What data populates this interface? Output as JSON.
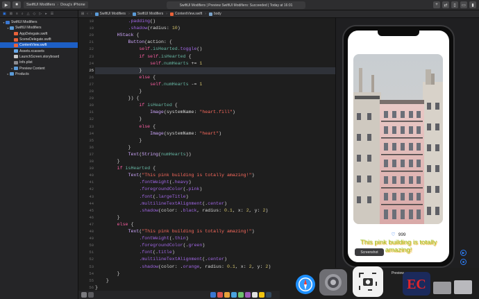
{
  "toolbar": {
    "scheme_project": "SwiftUI Modifiers",
    "scheme_device": "Doug's iPhone",
    "activity": "SwiftUI Modifiers | Preview SwiftUI Modifiers: Succeeded | Today at 16:01"
  },
  "jumpbar": {
    "crumbs": [
      "SwiftUI Modifiers",
      "SwiftUI Modifiers",
      "ContentView.swift",
      "body"
    ]
  },
  "navigator": {
    "items": [
      {
        "label": "SwiftUI Modifiers",
        "indent": 0,
        "icon": "proj",
        "disclosure": "▾",
        "selected": false
      },
      {
        "label": "SwiftUI Modifiers",
        "indent": 1,
        "icon": "folder",
        "disclosure": "▾",
        "selected": false
      },
      {
        "label": "AppDelegate.swift",
        "indent": 2,
        "icon": "swift",
        "disclosure": "",
        "selected": false
      },
      {
        "label": "SceneDelegate.swift",
        "indent": 2,
        "icon": "swift",
        "disclosure": "",
        "selected": false
      },
      {
        "label": "ContentView.swift",
        "indent": 2,
        "icon": "swift",
        "disclosure": "",
        "selected": true
      },
      {
        "label": "Assets.xcassets",
        "indent": 2,
        "icon": "assets",
        "disclosure": "",
        "selected": false
      },
      {
        "label": "LaunchScreen.storyboard",
        "indent": 2,
        "icon": "file",
        "disclosure": "",
        "selected": false
      },
      {
        "label": "Info.plist",
        "indent": 2,
        "icon": "grey",
        "disclosure": "",
        "selected": false
      },
      {
        "label": "Preview Content",
        "indent": 2,
        "icon": "folder",
        "disclosure": "▸",
        "selected": false
      },
      {
        "label": "Products",
        "indent": 1,
        "icon": "folder",
        "disclosure": "▸",
        "selected": false
      }
    ]
  },
  "editor": {
    "current_line": 25,
    "lines": [
      {
        "n": 18,
        "tokens": [
          [
            "            ",
            "id"
          ],
          [
            ".padding",
            "prop"
          ],
          [
            "()",
            "id"
          ]
        ]
      },
      {
        "n": 19,
        "tokens": [
          [
            "            ",
            "id"
          ],
          [
            ".shadow",
            "prop"
          ],
          [
            "(radius: ",
            "id"
          ],
          [
            "10",
            "num"
          ],
          [
            ")",
            "id"
          ]
        ]
      },
      {
        "n": 20,
        "tokens": [
          [
            "        ",
            "id"
          ],
          [
            "HStack",
            "type"
          ],
          [
            " {",
            "id"
          ]
        ]
      },
      {
        "n": 21,
        "tokens": [
          [
            "            ",
            "id"
          ],
          [
            "Button",
            "type"
          ],
          [
            "(action: {",
            "id"
          ]
        ]
      },
      {
        "n": 22,
        "tokens": [
          [
            "                ",
            "id"
          ],
          [
            "self",
            "kw"
          ],
          [
            ".isHearted.",
            "fn"
          ],
          [
            "toggle",
            "prop"
          ],
          [
            "()",
            "id"
          ]
        ]
      },
      {
        "n": 23,
        "tokens": [
          [
            "                ",
            "id"
          ],
          [
            "if",
            "kw"
          ],
          [
            " ",
            "id"
          ],
          [
            "self",
            "kw"
          ],
          [
            ".isHearted",
            "fn"
          ],
          [
            " {",
            "id"
          ]
        ]
      },
      {
        "n": 24,
        "tokens": [
          [
            "                    ",
            "id"
          ],
          [
            "self",
            "kw"
          ],
          [
            ".numHearts",
            "fn"
          ],
          [
            " += ",
            "id"
          ],
          [
            "1",
            "num"
          ]
        ]
      },
      {
        "n": 25,
        "tokens": [
          [
            "                ",
            "id"
          ],
          [
            "}",
            "id"
          ]
        ]
      },
      {
        "n": 26,
        "tokens": [
          [
            "                ",
            "id"
          ],
          [
            "else",
            "kw"
          ],
          [
            " {",
            "id"
          ]
        ]
      },
      {
        "n": 27,
        "tokens": [
          [
            "                    ",
            "id"
          ],
          [
            "self",
            "kw"
          ],
          [
            ".numHearts",
            "fn"
          ],
          [
            " -= ",
            "id"
          ],
          [
            "1",
            "num"
          ]
        ]
      },
      {
        "n": 28,
        "tokens": [
          [
            "                ",
            "id"
          ],
          [
            "}",
            "id"
          ]
        ]
      },
      {
        "n": 29,
        "tokens": [
          [
            "            ",
            "id"
          ],
          [
            "}) {",
            "id"
          ]
        ]
      },
      {
        "n": 30,
        "tokens": [
          [
            "                ",
            "id"
          ],
          [
            "if",
            "kw"
          ],
          [
            " ",
            "id"
          ],
          [
            "isHearted",
            "fn"
          ],
          [
            " {",
            "id"
          ]
        ]
      },
      {
        "n": 31,
        "tokens": [
          [
            "                    ",
            "id"
          ],
          [
            "Image",
            "type"
          ],
          [
            "(systemName: ",
            "id"
          ],
          [
            "\"heart.fill\"",
            "str"
          ],
          [
            ")",
            "id"
          ]
        ]
      },
      {
        "n": 32,
        "tokens": [
          [
            "                ",
            "id"
          ],
          [
            "}",
            "id"
          ]
        ]
      },
      {
        "n": 33,
        "tokens": [
          [
            "                ",
            "id"
          ],
          [
            "else",
            "kw"
          ],
          [
            " {",
            "id"
          ]
        ]
      },
      {
        "n": 34,
        "tokens": [
          [
            "                    ",
            "id"
          ],
          [
            "Image",
            "type"
          ],
          [
            "(systemName: ",
            "id"
          ],
          [
            "\"heart\"",
            "str"
          ],
          [
            ")",
            "id"
          ]
        ]
      },
      {
        "n": 35,
        "tokens": [
          [
            "                ",
            "id"
          ],
          [
            "}",
            "id"
          ]
        ]
      },
      {
        "n": 36,
        "tokens": [
          [
            "            ",
            "id"
          ],
          [
            "}",
            "id"
          ]
        ]
      },
      {
        "n": 37,
        "tokens": [
          [
            "            ",
            "id"
          ],
          [
            "Text",
            "type"
          ],
          [
            "(",
            "id"
          ],
          [
            "String",
            "type"
          ],
          [
            "(",
            "id"
          ],
          [
            "numHearts",
            "fn"
          ],
          [
            "))",
            "id"
          ]
        ]
      },
      {
        "n": 38,
        "tokens": [
          [
            "        ",
            "id"
          ],
          [
            "}",
            "id"
          ]
        ]
      },
      {
        "n": 39,
        "tokens": [
          [
            "        ",
            "id"
          ],
          [
            "if",
            "kw"
          ],
          [
            " ",
            "id"
          ],
          [
            "isHearted",
            "fn"
          ],
          [
            " {",
            "id"
          ]
        ]
      },
      {
        "n": 40,
        "tokens": [
          [
            "            ",
            "id"
          ],
          [
            "Text",
            "type"
          ],
          [
            "(",
            "id"
          ],
          [
            "\"This pink building is totally amazing!\"",
            "str"
          ],
          [
            ")",
            "id"
          ]
        ]
      },
      {
        "n": 41,
        "tokens": [
          [
            "                ",
            "id"
          ],
          [
            ".fontWeight",
            "prop"
          ],
          [
            "(.",
            "id"
          ],
          [
            "heavy",
            "prop"
          ],
          [
            ")",
            "id"
          ]
        ]
      },
      {
        "n": 42,
        "tokens": [
          [
            "                ",
            "id"
          ],
          [
            ".foregroundColor",
            "prop"
          ],
          [
            "(.",
            "id"
          ],
          [
            "pink",
            "prop"
          ],
          [
            ")",
            "id"
          ]
        ]
      },
      {
        "n": 43,
        "tokens": [
          [
            "                ",
            "id"
          ],
          [
            ".font",
            "prop"
          ],
          [
            "(.",
            "id"
          ],
          [
            "largeTitle",
            "prop"
          ],
          [
            ")",
            "id"
          ]
        ]
      },
      {
        "n": 44,
        "tokens": [
          [
            "                ",
            "id"
          ],
          [
            ".multilineTextAlignment",
            "prop"
          ],
          [
            "(.",
            "id"
          ],
          [
            "center",
            "prop"
          ],
          [
            ")",
            "id"
          ]
        ]
      },
      {
        "n": 45,
        "tokens": [
          [
            "                ",
            "id"
          ],
          [
            ".shadow",
            "prop"
          ],
          [
            "(color: .",
            "id"
          ],
          [
            "black",
            "prop"
          ],
          [
            ", radius: ",
            "id"
          ],
          [
            "0.1",
            "num"
          ],
          [
            ", x: ",
            "id"
          ],
          [
            "2",
            "num"
          ],
          [
            ", y: ",
            "id"
          ],
          [
            "2",
            "num"
          ],
          [
            ")",
            "id"
          ]
        ]
      },
      {
        "n": 46,
        "tokens": [
          [
            "        ",
            "id"
          ],
          [
            "}",
            "id"
          ]
        ]
      },
      {
        "n": 47,
        "tokens": [
          [
            "        ",
            "id"
          ],
          [
            "else",
            "kw"
          ],
          [
            " {",
            "id"
          ]
        ]
      },
      {
        "n": 48,
        "tokens": [
          [
            "            ",
            "id"
          ],
          [
            "Text",
            "type"
          ],
          [
            "(",
            "id"
          ],
          [
            "\"This pink building is totally amazing!\"",
            "str"
          ],
          [
            ")",
            "id"
          ]
        ]
      },
      {
        "n": 49,
        "tokens": [
          [
            "                ",
            "id"
          ],
          [
            ".fontWeight",
            "prop"
          ],
          [
            "(.",
            "id"
          ],
          [
            "thin",
            "prop"
          ],
          [
            ")",
            "id"
          ]
        ]
      },
      {
        "n": 50,
        "tokens": [
          [
            "                ",
            "id"
          ],
          [
            ".foregroundColor",
            "prop"
          ],
          [
            "(.",
            "id"
          ],
          [
            "green",
            "prop"
          ],
          [
            ")",
            "id"
          ]
        ]
      },
      {
        "n": 51,
        "tokens": [
          [
            "                ",
            "id"
          ],
          [
            ".font",
            "prop"
          ],
          [
            "(.",
            "id"
          ],
          [
            "title",
            "prop"
          ],
          [
            ")",
            "id"
          ]
        ]
      },
      {
        "n": 52,
        "tokens": [
          [
            "                ",
            "id"
          ],
          [
            ".multilineTextAlignment",
            "prop"
          ],
          [
            "(.",
            "id"
          ],
          [
            "center",
            "prop"
          ],
          [
            ")",
            "id"
          ]
        ]
      },
      {
        "n": 53,
        "tokens": [
          [
            "                ",
            "id"
          ],
          [
            ".shadow",
            "prop"
          ],
          [
            "(color: .",
            "id"
          ],
          [
            "orange",
            "prop"
          ],
          [
            ", radius: ",
            "id"
          ],
          [
            "0.1",
            "num"
          ],
          [
            ", x: ",
            "id"
          ],
          [
            "2",
            "num"
          ],
          [
            ", y: ",
            "id"
          ],
          [
            "2",
            "num"
          ],
          [
            ")",
            "id"
          ]
        ]
      },
      {
        "n": 54,
        "tokens": [
          [
            "        ",
            "id"
          ],
          [
            "}",
            "id"
          ]
        ]
      },
      {
        "n": 55,
        "tokens": [
          [
            "    ",
            "id"
          ],
          [
            "}",
            "id"
          ]
        ]
      },
      {
        "n": 56,
        "tokens": [
          [
            "}",
            "id"
          ]
        ]
      }
    ]
  },
  "preview": {
    "heart_count": "999",
    "caption": "This pink building is totally amazing!",
    "screenshot_tooltip": "Screenshot"
  },
  "dock": {
    "preview_label": "Preview"
  },
  "colors": {
    "accent": "#1d5fc5",
    "keyword": "#fc5fa3",
    "string": "#fc6a5d",
    "type": "#d0a8ff",
    "number": "#d0bf69",
    "caption_green": "#9bc93c",
    "caption_shadow": "#f4a000"
  },
  "icons": [
    "run-icon",
    "stop-icon",
    "safari-icon",
    "system-preferences-icon",
    "screenshot-icon",
    "ec-app-icon",
    "folder-icon",
    "trash-icon",
    "heart-icon"
  ]
}
